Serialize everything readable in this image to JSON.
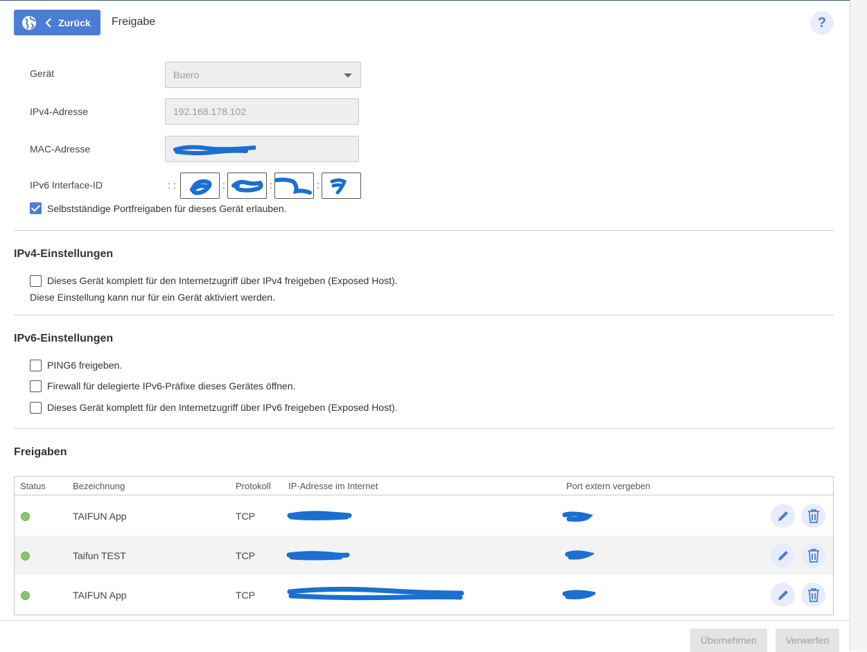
{
  "header": {
    "back_label": "Zurück",
    "title": "Freigabe",
    "help_label": "?"
  },
  "device": {
    "geraet_label": "Gerät",
    "geraet_value": "Buero",
    "ipv4_label": "IPv4-Adresse",
    "ipv4_value": "192.168.178.102",
    "mac_label": "MAC-Adresse",
    "ipv6_label": "IPv6 Interface-ID",
    "ipv6_prefix": ": :",
    "ipv6_sep": ":",
    "allow_label": "Selbstständige Portfreigaben für dieses Gerät erlauben."
  },
  "ipv4_section": {
    "title": "IPv4-Einstellungen",
    "exposed_label": "Dieses Gerät komplett für den Internetzugriff über IPv4 freigeben (Exposed Host).",
    "note": "Diese Einstellung kann nur für ein Gerät aktiviert werden."
  },
  "ipv6_section": {
    "title": "IPv6-Einstellungen",
    "ping_label": "PING6 freigeben.",
    "firewall_label": "Firewall für delegierte IPv6-Präfixe dieses Gerätes öffnen.",
    "exposed_label": "Dieses Gerät komplett für den Internetzugriff über IPv6 freigeben (Exposed Host)."
  },
  "freigaben": {
    "title": "Freigaben",
    "columns": [
      "Status",
      "Bezeichnung",
      "Protokoll",
      "IP-Adresse im Internet",
      "Port extern vergeben"
    ],
    "rows": [
      {
        "name": "TAIFUN App",
        "protocol": "TCP"
      },
      {
        "name": "Taifun TEST",
        "protocol": "TCP"
      },
      {
        "name": "TAIFUN App",
        "protocol": "TCP"
      }
    ]
  },
  "footer": {
    "apply_label": "Übernehmen",
    "discard_label": "Verwerfen"
  },
  "colors": {
    "accent": "#4a7dd6",
    "status_active": "#8cc46a",
    "redaction": "#1a6fd0"
  }
}
